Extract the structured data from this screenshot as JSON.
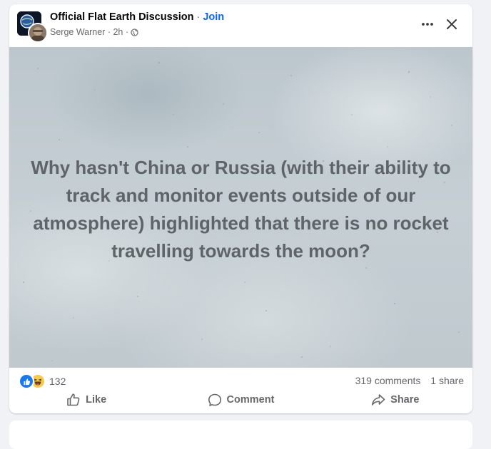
{
  "post": {
    "group_name": "Official Flat Earth Discussion",
    "separator": "·",
    "join_label": "Join",
    "author": "Serge Warner",
    "time": "2h",
    "meta_separator": "·",
    "privacy_icon": "globe-icon",
    "more_icon": "more-icon",
    "close_icon": "close-icon",
    "image_text": "Why hasn't China or Russia (with their ability to track and monitor events outside of our atmosphere) highlighted that there is no rocket travelling towards the moon?"
  },
  "stats": {
    "reaction_icons": [
      "like-reaction-icon",
      "haha-reaction-icon"
    ],
    "reaction_count": "132",
    "comments": "319 comments",
    "shares": "1 share"
  },
  "actions": {
    "like_label": "Like",
    "comment_label": "Comment",
    "share_label": "Share"
  },
  "colors": {
    "link": "#0866ff",
    "secondary_text": "#65676b",
    "like_reaction": "#1877f2",
    "haha_reaction": "#f7c94b",
    "page_background": "#f0f2f5"
  }
}
